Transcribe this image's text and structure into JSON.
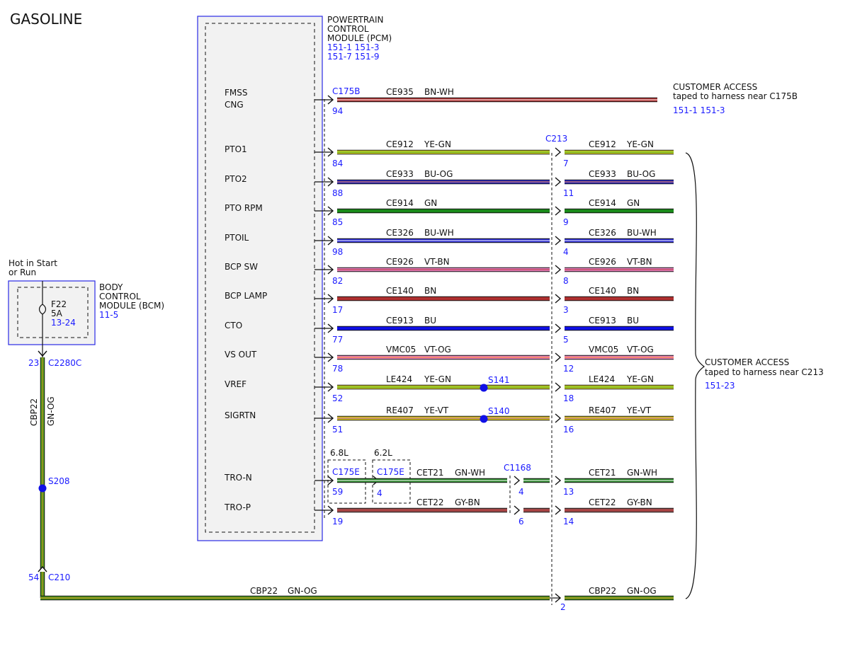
{
  "title": "GASOLINE",
  "colors": {
    "ink": "#111111",
    "ref": "#1a1aff",
    "module_fill": "#f2f2f2",
    "module_border": "#2a2ae6",
    "GN-OG": "#3d8a1a",
    "BN-WH": "#b03030",
    "YE-GN": "#dede2a",
    "BU-OG": "#2a2ad6",
    "GN": "#1a8a1a",
    "BU-WH": "#2a2ad6",
    "VT-BN": "#e680c0",
    "BN": "#b03030",
    "BU": "#1010e6",
    "VT-OG": "#e680c0",
    "YE-VT": "#e6d21a",
    "GN-WH": "#2a8a2a",
    "GY-BN": "#a05050"
  },
  "pcm": {
    "name_lines": [
      "POWERTRAIN",
      "CONTROL",
      "MODULE (PCM)"
    ],
    "refs": [
      "151-1 151-3",
      "151-7 151-9"
    ]
  },
  "bcm": {
    "name_lines": [
      "BODY",
      "CONTROL",
      "MODULE (BCM)"
    ],
    "ref": "11-5",
    "hot_lines": [
      "Hot in Start",
      "or Run"
    ],
    "fuse_name": "F22",
    "fuse_rating": "5A",
    "fuse_ref": "13-24"
  },
  "customer_access_top": {
    "line1": "CUSTOMER ACCESS",
    "line2": "taped to harness near C175B",
    "ref": "151-1 151-3"
  },
  "customer_access_group": {
    "line1": "CUSTOMER ACCESS",
    "line2": "taped to harness near C213",
    "ref": "151-23"
  },
  "connectors": {
    "pcm": "C175B",
    "mid": "C213",
    "bcm": "C2280C",
    "c210": "C210",
    "c1168": "C1168",
    "c175e_a": "C175E",
    "c175e_b": "C175E",
    "engine_a": "6.8L",
    "engine_b": "6.2L"
  },
  "signals": [
    {
      "label": "FMSS",
      "label2": "CNG",
      "circuit": "CE935",
      "color": "BN-WH",
      "pin": "94"
    },
    {
      "label": "PTO1",
      "circuit": "CE912",
      "color": "YE-GN",
      "pin": "84",
      "pin2": "7",
      "circuit2": "CE912",
      "color2": "YE-GN"
    },
    {
      "label": "PTO2",
      "circuit": "CE933",
      "color": "BU-OG",
      "pin": "88",
      "pin2": "11",
      "circuit2": "CE933",
      "color2": "BU-OG"
    },
    {
      "label": "PTO RPM",
      "circuit": "CE914",
      "color": "GN",
      "pin": "85",
      "pin2": "9",
      "circuit2": "CE914",
      "color2": "GN"
    },
    {
      "label": "PTOIL",
      "circuit": "CE326",
      "color": "BU-WH",
      "pin": "98",
      "pin2": "4",
      "circuit2": "CE326",
      "color2": "BU-WH"
    },
    {
      "label": "BCP SW",
      "circuit": "CE926",
      "color": "VT-BN",
      "pin": "82",
      "pin2": "8",
      "circuit2": "CE926",
      "color2": "VT-BN"
    },
    {
      "label": "BCP LAMP",
      "circuit": "CE140",
      "color": "BN",
      "pin": "17",
      "pin2": "3",
      "circuit2": "CE140",
      "color2": "BN"
    },
    {
      "label": "CTO",
      "circuit": "CE913",
      "color": "BU",
      "pin": "77",
      "pin2": "5",
      "circuit2": "CE913",
      "color2": "BU"
    },
    {
      "label": "VS OUT",
      "circuit": "VMC05",
      "color": "VT-OG",
      "pin": "78",
      "pin2": "12",
      "circuit2": "VMC05",
      "color2": "VT-OG"
    },
    {
      "label": "VREF",
      "circuit": "LE424",
      "color": "YE-GN",
      "pin": "52",
      "pin2": "18",
      "circuit2": "LE424",
      "color2": "YE-GN",
      "splice": "S141"
    },
    {
      "label": "SIGRTN",
      "circuit": "RE407",
      "color": "YE-VT",
      "pin": "51",
      "pin2": "16",
      "circuit2": "RE407",
      "color2": "YE-VT",
      "splice": "S140"
    },
    {
      "label": "TRO-N",
      "circuit": "CET21",
      "color": "GN-WH",
      "pin": "59",
      "pin_e": "4",
      "pin_c1168": "4",
      "pin2": "13",
      "circuit2": "CET21",
      "color2": "GN-WH"
    },
    {
      "label": "TRO-P",
      "circuit": "CET22",
      "color": "GY-BN",
      "pin": "19",
      "pin_c1168": "6",
      "pin2": "14",
      "circuit2": "CET22",
      "color2": "GY-BN"
    }
  ],
  "feed": {
    "circuit": "CBP22",
    "color": "GN-OG",
    "pin_bcm": "23",
    "splice": "S208",
    "pin_c210": "54",
    "pin_c213": "2",
    "circuit2": "CBP22",
    "color2": "GN-OG"
  }
}
